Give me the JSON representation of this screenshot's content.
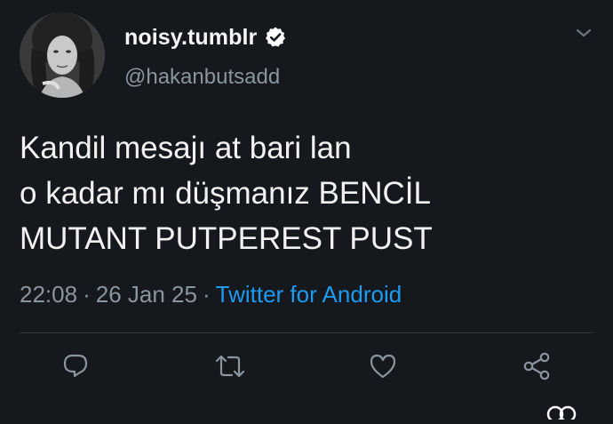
{
  "tweet": {
    "display_name": "noisy.tumblr",
    "handle": "@hakanbutsadd",
    "verified": true,
    "text_lines": [
      "Kandil mesajı at bari lan",
      "o kadar mı düşmanız BENCİL",
      "MUTANT PUTPEREST PUST"
    ],
    "time": "22:08",
    "separator": "·",
    "date": "26 Jan 25",
    "source": "Twitter for Android"
  },
  "icons": {
    "verified": "verified-badge-icon",
    "menu": "chevron-down-icon",
    "reply": "reply-icon",
    "retweet": "retweet-icon",
    "like": "heart-icon",
    "share": "share-icon"
  },
  "colors": {
    "background": "#15181c",
    "text": "#f2f2f2",
    "secondary": "#8b959e",
    "link": "#1d9bf0"
  }
}
